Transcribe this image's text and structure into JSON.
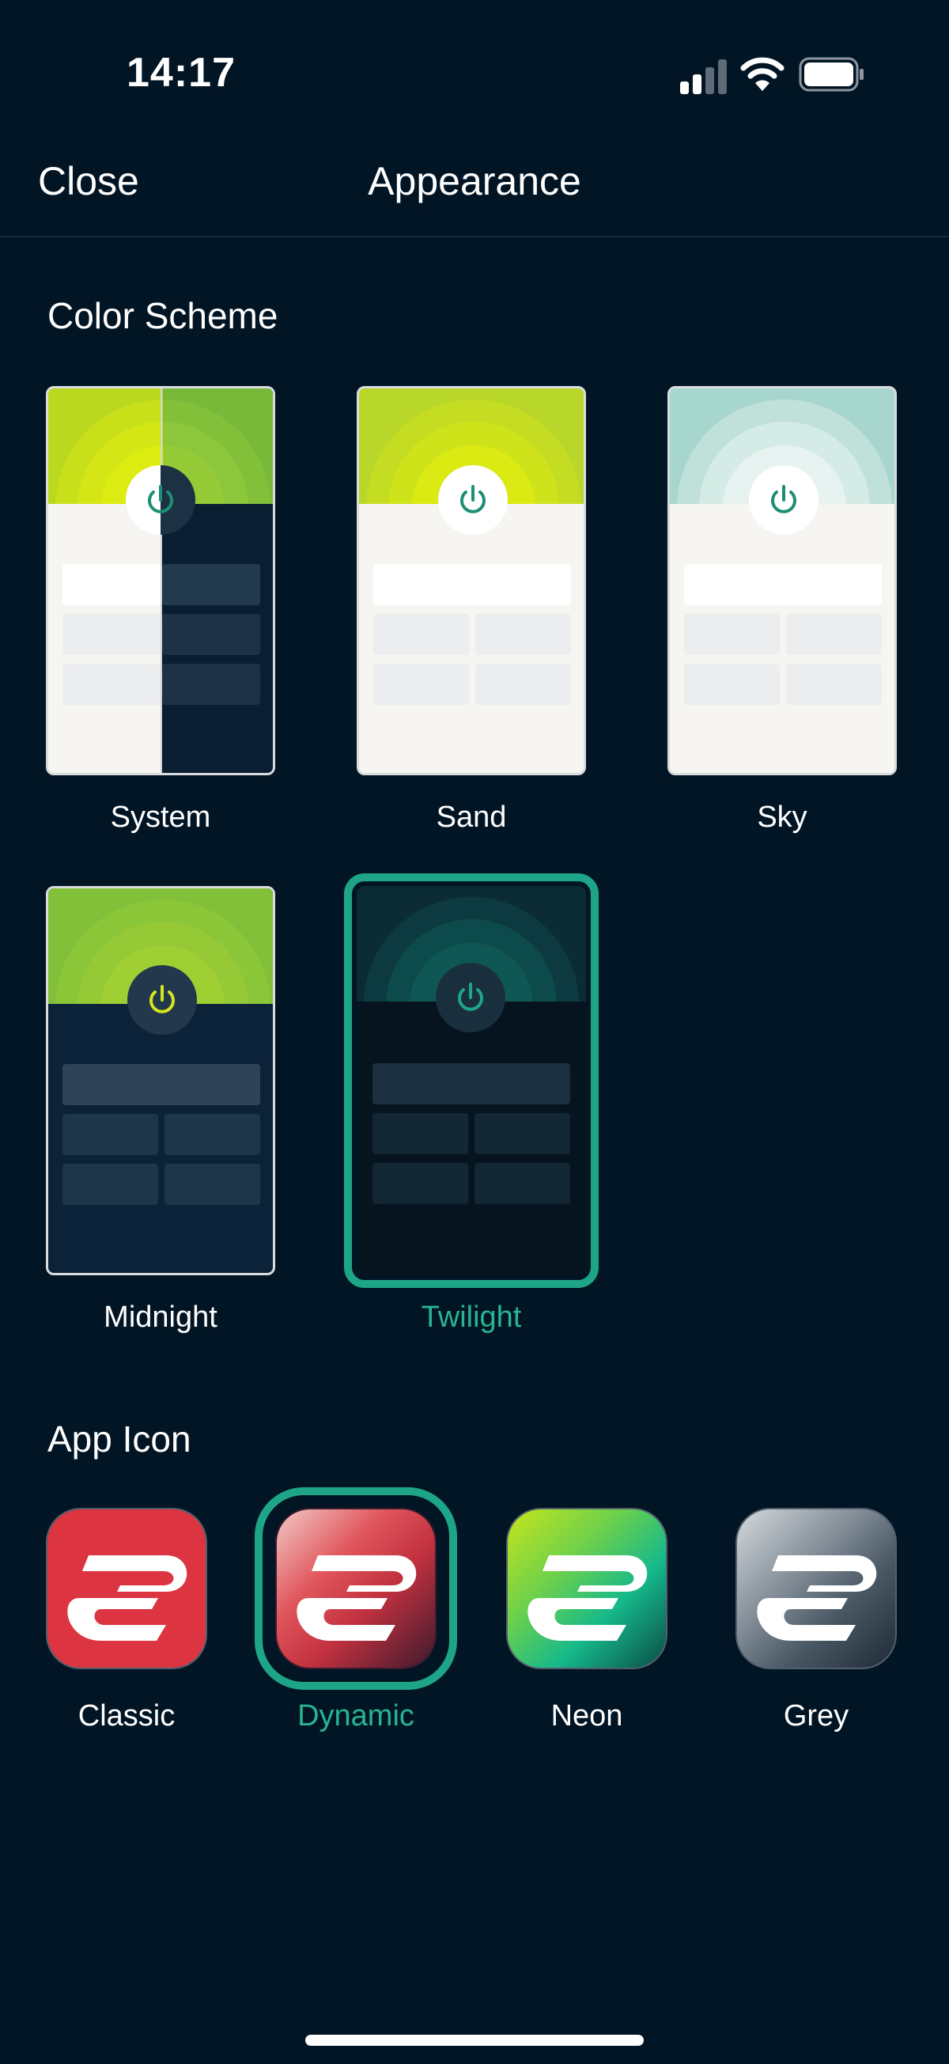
{
  "status": {
    "time": "14:17"
  },
  "nav": {
    "close_label": "Close",
    "title": "Appearance"
  },
  "color_scheme": {
    "section_title": "Color Scheme",
    "options": [
      {
        "label": "System"
      },
      {
        "label": "Sand"
      },
      {
        "label": "Sky"
      },
      {
        "label": "Midnight"
      },
      {
        "label": "Twilight",
        "selected": true
      }
    ]
  },
  "app_icon": {
    "section_title": "App Icon",
    "options": [
      {
        "label": "Classic"
      },
      {
        "label": "Dynamic",
        "selected": true
      },
      {
        "label": "Neon"
      },
      {
        "label": "Grey"
      }
    ]
  },
  "colors": {
    "background": "#021525",
    "accent": "#1ea587",
    "accent_text": "#28b391",
    "classic_red": "#dc3440",
    "neon_green": "#8fd62a",
    "grey": "#5e6b78"
  },
  "icons": {
    "signal": "cellular-signal-icon",
    "wifi": "wifi-icon",
    "battery": "battery-icon",
    "power": "power-icon",
    "logo": "expressvpn-logo-icon"
  }
}
